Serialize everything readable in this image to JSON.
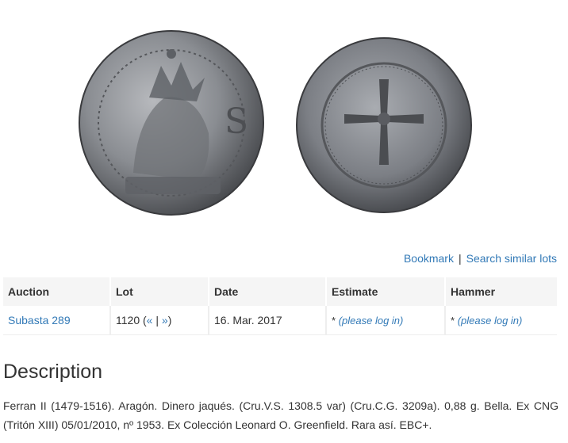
{
  "actions": {
    "bookmark": "Bookmark",
    "separator": "|",
    "search_similar": "Search similar lots"
  },
  "table": {
    "headers": [
      "Auction",
      "Lot",
      "Date",
      "Estimate",
      "Hammer"
    ],
    "row": {
      "auction": "Subasta 289",
      "lot_number": "1120",
      "lot_prev": "«",
      "lot_sep": "|",
      "lot_next": "»",
      "date": "16. Mar. 2017",
      "estimate_prefix": "*",
      "estimate_link": "please log in",
      "hammer_prefix": "*",
      "hammer_link": "please log in"
    }
  },
  "description": {
    "title": "Description",
    "text": "Ferran II (1479-1516). Aragón. Dinero jaqués. (Cru.V.S. 1308.5 var) (Cru.C.G. 3209a). 0,88 g. Bella. Ex CNG (Tritón XIII) 05/01/2010, nº 1953. Ex Colección Leonard O. Greenfield. Rara así. EBC+."
  },
  "colors": {
    "link": "#337ab7",
    "header_bg": "#f5f5f5",
    "coin_metal": "#8a8d92"
  }
}
